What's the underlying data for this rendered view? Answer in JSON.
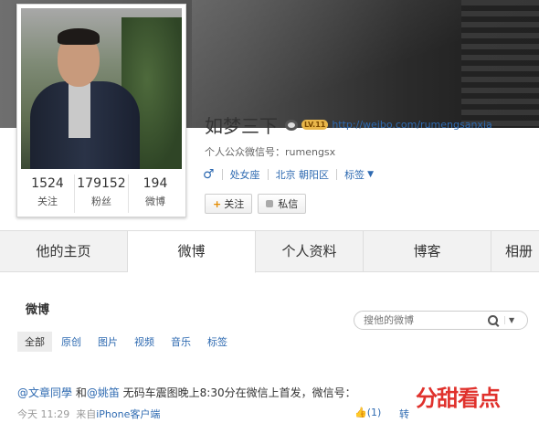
{
  "profile": {
    "name": "如梦三下",
    "level_badge": "LV.11",
    "homepage_url": "http://weibo.com/rumengsanxia",
    "wechat": "个人公众微信号：rumengsx",
    "gender_icon": "male-icon",
    "zodiac": "处女座",
    "location": "北京 朝阳区",
    "tags_label": "标签"
  },
  "stats": [
    {
      "num": "1524",
      "label": "关注"
    },
    {
      "num": "179152",
      "label": "粉丝"
    },
    {
      "num": "194",
      "label": "微博"
    }
  ],
  "actions": {
    "follow": "关注",
    "message": "私信"
  },
  "tabs": [
    "他的主页",
    "微博",
    "个人资料",
    "博客",
    "相册"
  ],
  "active_tab": "微博",
  "section_title": "微博",
  "search": {
    "placeholder": "搜他的微博"
  },
  "filters": [
    "全部",
    "原创",
    "图片",
    "视频",
    "音乐",
    "标签"
  ],
  "post": {
    "mention1": "@文章同學",
    "and": " 和",
    "mention2": "@姚笛",
    "text": " 无码车震图晚上8:30分在微信上首发，微信号：",
    "time": "今天 11:29",
    "source_prefix": "来自",
    "source": "iPhone客户端",
    "like": "(1)",
    "forward": "转"
  },
  "watermark": "分甜看点",
  "colors": {
    "link": "#2e6ab1",
    "accent": "#e48b00",
    "watermark": "#e0312c"
  }
}
